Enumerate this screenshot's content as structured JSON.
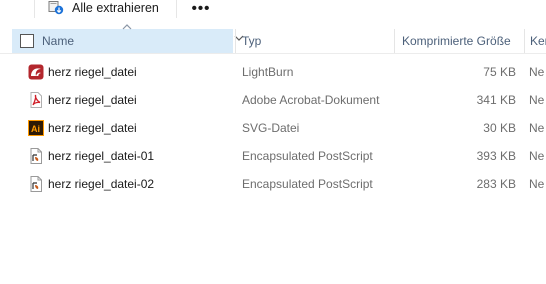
{
  "toolbar": {
    "extract_all_label": "Alle extrahieren",
    "more_label": "•••"
  },
  "columns": {
    "name": "Name",
    "type": "Typ",
    "compressed_size": "Komprimierte Größe",
    "next": "Ker"
  },
  "files": [
    {
      "name": "herz riegel_datei",
      "type": "LightBurn",
      "size": "75 KB",
      "extra": "Ne",
      "icon": "lightburn-icon"
    },
    {
      "name": "herz riegel_datei",
      "type": "Adobe Acrobat-Dokument",
      "size": "341 KB",
      "extra": "Ne",
      "icon": "pdf-icon"
    },
    {
      "name": "herz riegel_datei",
      "type": "SVG-Datei",
      "size": "30 KB",
      "extra": "Ne",
      "icon": "illustrator-icon"
    },
    {
      "name": "herz riegel_datei-01",
      "type": "Encapsulated PostScript",
      "size": "393 KB",
      "extra": "Ne",
      "icon": "eps-file-icon"
    },
    {
      "name": "herz riegel_datei-02",
      "type": "Encapsulated PostScript",
      "size": "283 KB",
      "extra": "Ne",
      "icon": "eps-file-icon"
    }
  ]
}
